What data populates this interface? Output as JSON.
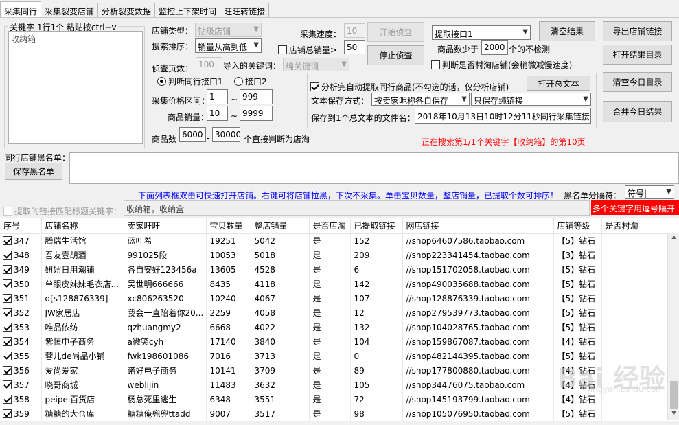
{
  "tabs": [
    {
      "label": "采集同行",
      "active": true
    },
    {
      "label": "采集裂变店铺",
      "active": false
    },
    {
      "label": "分析裂变数据",
      "active": false
    },
    {
      "label": "监控上下架时间",
      "active": false
    },
    {
      "label": "旺旺转链接",
      "active": false
    }
  ],
  "keywords": {
    "legend": "关键字 1行1个 粘贴按ctrl+v",
    "value": "收纳箱"
  },
  "form": {
    "shop_type_label": "店铺类型：",
    "shop_type_value": "钻级店铺",
    "sort_label": "搜索排序：",
    "sort_value": "销量从高到低",
    "pages_label": "侦查页数：",
    "pages_value": "100",
    "imported_kw_label": "导入的关键词：",
    "imported_kw_value": "纯关键词",
    "speed_label": "采集速度：",
    "speed_value": "10",
    "total_sales_label": "店铺总销量>",
    "total_sales_value": "50",
    "radio1": "判断同行接口1",
    "radio2": "接口2",
    "price_label": "采集价格区间：",
    "price_min": "1",
    "price_max": "999",
    "tilde": "~",
    "sales_label": "商品销量：",
    "sales_min": "10",
    "sales_max": "9999",
    "count_label": "商品数",
    "count_min": "6000",
    "count_sep": "-",
    "count_max": "30000",
    "count_suffix": "个直接判断为店淘"
  },
  "buttons": {
    "start": "开始侦查",
    "stop": "停止侦查",
    "clear_results": "清空结果",
    "export_links": "导出店铺链接",
    "open_results_dir": "打开结果目录",
    "clear_today_dir": "清空今日目录",
    "merge_today": "合并今日结果",
    "open_total_text": "打开总文本",
    "save_blacklist": "保存黑名单"
  },
  "interface": {
    "select_value": "提取接口1",
    "min_goods_prefix": "商品数少于",
    "min_goods_value": "2000",
    "min_goods_suffix": "个的不检测",
    "check_cuntao": "判断是否村淘店铺(会稍微减慢速度)"
  },
  "analysis": {
    "auto_extract": "分析完自动提取同行商品(不勾选的话，仅分析店铺)",
    "save_mode_label": "文本保存方式：",
    "save_mode_value": "按卖家昵称各自保存",
    "save_link_value": "只保存纯链接",
    "total_file_label": "保存到1个总文本的文件名：",
    "total_file_value": "2018年10月13日10时12分11秒同行采集链接"
  },
  "status": {
    "message": "正在搜索第1/1个关键字【收纳箱】的第10页",
    "color": "#ff0000"
  },
  "blacklist": {
    "label": "同行店铺黑名单：",
    "hint": "下面列表框双击可快速打开店铺。右键可将店铺拉黑，下次不采集。单击宝贝数量，整店销量，已提取个数可排序！",
    "separator_label": "黑名单分隔符：",
    "separator_value": "符号|",
    "hint_color": "#0000ff"
  },
  "title_filter": {
    "label": "提取的链接匹配标题关键字：",
    "value": "收纳箱，收纳盒",
    "warning": "多个关键字用逗号隔开",
    "warning_bg": "#ff0000"
  },
  "table": {
    "headers": [
      "序号",
      "店铺名称",
      "卖家旺旺",
      "宝贝数量",
      "整店销量",
      "是否店淘",
      "已提取链接",
      "网店链接",
      "店铺等级",
      "是否村淘"
    ],
    "rows": [
      [
        "347",
        "腾瑞生活馆",
        "蓝叶希",
        "19251",
        "5042",
        "是",
        "152",
        "//shop64607586.taobao.com",
        "【5】钻石",
        ""
      ],
      [
        "348",
        "吾友壹胡酒",
        "991025段",
        "10053",
        "5018",
        "是",
        "209",
        "//shop223341454.taobao.com",
        "【3】钻石",
        ""
      ],
      [
        "349",
        "妞妞日用潮铺",
        "各自安好123456a",
        "13605",
        "4528",
        "是",
        "6",
        "//shop151702058.taobao.com",
        "【5】钻石",
        ""
      ],
      [
        "350",
        "单眼皮妹妹毛衣店...",
        "吴世明666666",
        "8435",
        "4118",
        "是",
        "142",
        "//shop490035688.taobao.com",
        "【5】钻石",
        ""
      ],
      [
        "351",
        "d[s128876339]",
        "xc806263520",
        "10240",
        "4067",
        "是",
        "107",
        "//shop128876339.taobao.com",
        "【5】钻石",
        ""
      ],
      [
        "352",
        "JW家居店",
        "我会一直陪着你20...",
        "2259",
        "4058",
        "是",
        "12",
        "//shop279539773.taobao.com",
        "【5】钻石",
        ""
      ],
      [
        "353",
        "唯品依纺",
        "qzhuangmy2",
        "6668",
        "4022",
        "是",
        "132",
        "//shop104028765.taobao.com",
        "【5】钻石",
        ""
      ],
      [
        "354",
        "紫恒电子商务",
        "a微笑cyh",
        "17140",
        "3840",
        "是",
        "104",
        "//shop159867087.taobao.com",
        "【4】钻石",
        ""
      ],
      [
        "355",
        "蓉儿de尚品小铺",
        "fwk198601086",
        "7016",
        "3713",
        "是",
        "0",
        "//shop482144395.taobao.com",
        "【5】钻石",
        ""
      ],
      [
        "356",
        "爱尚爱家",
        "诺好电子商务",
        "10141",
        "3709",
        "是",
        "89",
        "//shop177800880.taobao.com",
        "【4】钻石",
        ""
      ],
      [
        "357",
        "晓哥商城",
        "weblijin",
        "11483",
        "3632",
        "是",
        "105",
        "//shop34476075.taobao.com",
        "【4】钻石",
        ""
      ],
      [
        "358",
        "peipei百货店",
        "杨总死里逃生",
        "6348",
        "3551",
        "是",
        "72",
        "//shop145193799.taobao.com",
        "【4】钻石",
        ""
      ],
      [
        "359",
        "糖糖的大仓库",
        "糖糖俺兜兜ttadd",
        "9007",
        "3517",
        "是",
        "98",
        "//shop105076950.taobao.com",
        "【5】钻石",
        ""
      ]
    ]
  },
  "watermark": {
    "main": "Bai 经验",
    "sub": "jingyan.baidu.com"
  }
}
